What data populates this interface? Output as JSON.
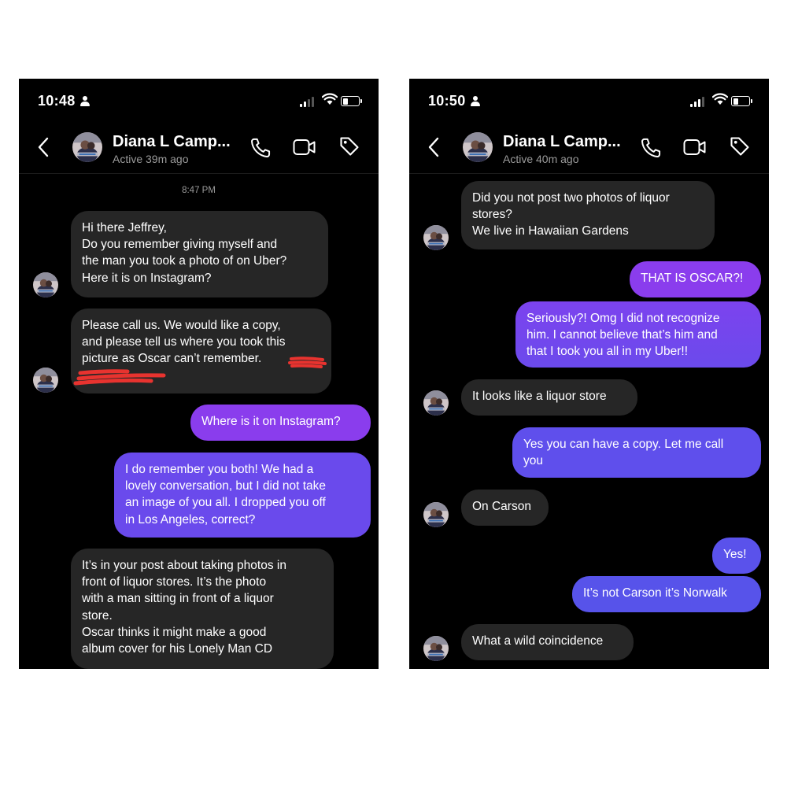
{
  "screens": [
    {
      "status": {
        "time": "10:48"
      },
      "header": {
        "name": "Diana L Camp...",
        "active": "Active 39m ago"
      },
      "timestamp": "8:47 PM",
      "messages": [
        {
          "from": "them",
          "text": "Hi there Jeffrey,\nDo you remember giving myself and\nthe man you took a photo of on Uber?\nHere it is on Instagram?"
        },
        {
          "from": "them",
          "text": "Please call us. We would like a copy,\nand please tell us where you took this\npicture as Oscar can’t remember."
        },
        {
          "from": "me",
          "text": "Where is it on Instagram?"
        },
        {
          "from": "me",
          "text": "I do remember you both! We had a\nlovely conversation, but I did not take\nan image of you all. I dropped you off\nin Los Angeles, correct?"
        },
        {
          "from": "them",
          "text": "It’s in your post about taking photos in\nfront of liquor stores. It’s the photo\nwith a man sitting in front of a liquor\nstore.\nOscar thinks it might make a good\nalbum cover for his Lonely Man CD"
        }
      ]
    },
    {
      "status": {
        "time": "10:50"
      },
      "header": {
        "name": "Diana L Camp...",
        "active": "Active 40m ago"
      },
      "messages": [
        {
          "from": "them",
          "text": "Did you not post two photos of liquor\nstores?\nWe live in Hawaiian Gardens"
        },
        {
          "from": "me",
          "text": "THAT IS OSCAR?!"
        },
        {
          "from": "me",
          "text": "Seriously?! Omg I did not recognize\nhim. I cannot believe that’s him and\nthat I took you all in my Uber!!"
        },
        {
          "from": "them",
          "text": "It looks like a liquor store"
        },
        {
          "from": "me",
          "text": "Yes you can have a copy. Let me call\nyou"
        },
        {
          "from": "them",
          "text": "On Carson"
        },
        {
          "from": "me",
          "text": "Yes!"
        },
        {
          "from": "me",
          "text": "It’s not Carson it’s Norwalk"
        },
        {
          "from": "them",
          "text": "What a wild coincidence"
        }
      ]
    }
  ],
  "icons": [
    "person-icon",
    "signal-icon",
    "wifi-icon",
    "battery-icon",
    "back-chevron-icon",
    "phone-call-icon",
    "video-call-icon",
    "tag-icon"
  ],
  "colors": {
    "background": "#000000",
    "incoming_bubble": "#262626",
    "outgoing_bubble_top": "#8a3ded",
    "outgoing_bubble_bottom": "#5753ea",
    "redaction": "#e8332f"
  }
}
